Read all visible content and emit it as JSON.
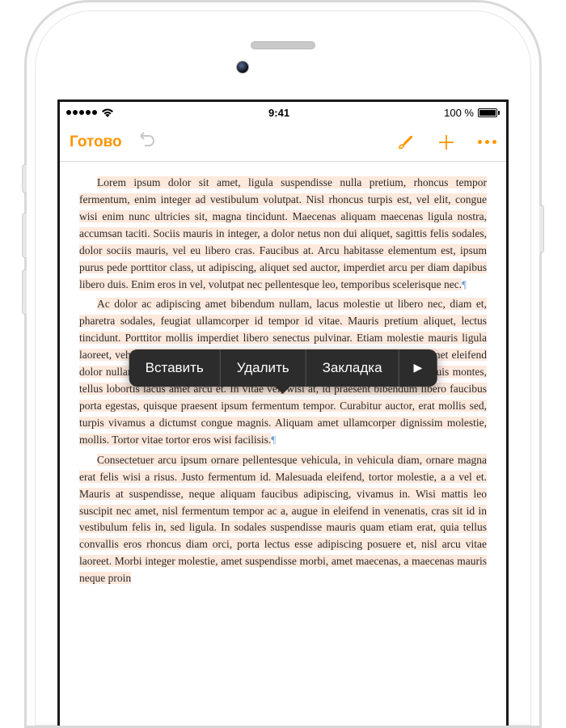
{
  "status_bar": {
    "time": "9:41",
    "battery_text": "100 %"
  },
  "toolbar": {
    "done_label": "Готово"
  },
  "context_menu": {
    "paste": "Вставить",
    "delete": "Удалить",
    "bookmark": "Закладка"
  },
  "document": {
    "p1": "Lorem ipsum dolor sit amet, ligula suspendisse nulla pretium, rhoncus tempor fermentum, enim integer ad vestibulum volutpat. Nisl rhoncus turpis est, vel elit, congue wisi enim nunc ultricies sit, magna tincidunt. Maecenas aliquam maecenas ligula nostra, accumsan taciti. Sociis mauris in integer, a dolor netus non dui aliquet, sagittis felis sodales, dolor sociis mauris, vel eu libero cras. Faucibus at. Arcu habitasse elementum est, ipsum purus pede porttitor class, ut adipiscing, aliquet sed auctor, imperdiet arcu per diam dapibus libero duis. Enim eros in vel, volutpat nec pellentesque leo, temporibus scelerisque nec.",
    "p2": "Ac dolor ac adipiscing amet bibendum nullam, lacus molestie ut libero nec, diam et, pharetra sodales, feugiat ullamcorper id tempor id vitae. Mauris pretium aliquet, lectus tincidunt. Porttitor mollis imperdiet libero senectus pulvinar. Etiam molestie mauris ligula laoreet, vehicula eleifend. Repellat orci erat et, sem cum, ultricies sollicitudin amet eleifend dolor nullam erat, malesuada est leo ac. Varius natoque turpis elementum est. Duis montes, tellus lobortis lacus amet arcu et. In vitae vel, wisi at, id praesent bibendum libero faucibus porta egestas, quisque praesent ipsum fermentum tempor. Curabitur auctor, erat mollis sed, turpis vivamus a dictumst congue magnis. Aliquam amet ullamcorper dignissim molestie, mollis. Tortor vitae tortor eros wisi facilisis.",
    "p3": "Consectetuer arcu ipsum ornare pellentesque vehicula, in vehicula diam, ornare magna erat felis wisi a risus. Justo fermentum id. Malesuada eleifend, tortor molestie, a a vel et. Mauris at suspendisse, neque aliquam faucibus adipiscing, vivamus in. Wisi mattis leo suscipit nec amet, nisl fermentum tempor ac a, augue in eleifend in venenatis, cras sit id in vestibulum felis in, sed ligula. In sodales suspendisse mauris quam etiam erat, quia tellus convallis eros rhoncus diam orci, porta lectus esse adipiscing posuere et, nisl arcu vitae laoreet. Morbi integer molestie, amet suspendisse morbi, amet maecenas, a maecenas mauris neque proin"
  }
}
